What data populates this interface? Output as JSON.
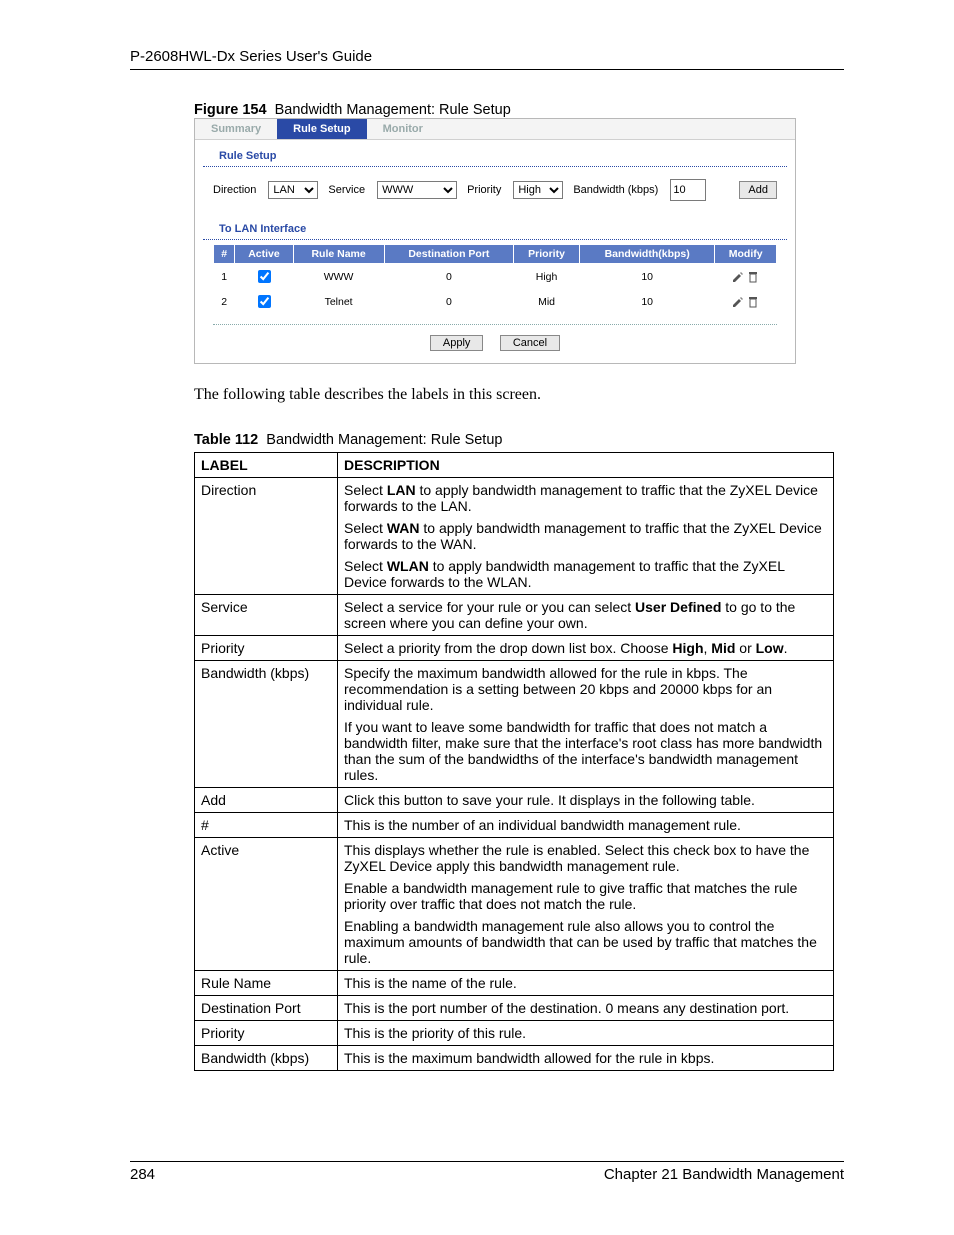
{
  "header": {
    "title": "P-2608HWL-Dx Series User's Guide"
  },
  "figure": {
    "label": "Figure 154",
    "title": "Bandwidth Management: Rule Setup"
  },
  "screenshot": {
    "tabs": {
      "summary": "Summary",
      "rule_setup": "Rule Setup",
      "monitor": "Monitor"
    },
    "section_rule_setup": "Rule Setup",
    "controls": {
      "direction_label": "Direction",
      "direction_value": "LAN",
      "service_label": "Service",
      "service_value": "WWW",
      "priority_label": "Priority",
      "priority_value": "High",
      "bandwidth_label": "Bandwidth (kbps)",
      "bandwidth_value": "10",
      "add_label": "Add"
    },
    "section_interface": "To LAN Interface",
    "columns": {
      "num": "#",
      "active": "Active",
      "rule_name": "Rule Name",
      "dest_port": "Destination Port",
      "priority": "Priority",
      "bandwidth": "Bandwidth(kbps)",
      "modify": "Modify"
    },
    "rows": [
      {
        "num": "1",
        "active": true,
        "rule_name": "WWW",
        "dest_port": "0",
        "priority": "High",
        "bandwidth": "10"
      },
      {
        "num": "2",
        "active": true,
        "rule_name": "Telnet",
        "dest_port": "0",
        "priority": "Mid",
        "bandwidth": "10"
      }
    ],
    "apply": "Apply",
    "cancel": "Cancel"
  },
  "intro_text": "The following table describes the labels in this screen.",
  "table_caption": {
    "label": "Table 112",
    "title": "Bandwidth Management: Rule Setup"
  },
  "desc_header": {
    "label": "LABEL",
    "description": "DESCRIPTION"
  },
  "desc_rows": {
    "direction": {
      "label": "Direction",
      "p1a": "Select ",
      "p1b": "LAN",
      "p1c": " to apply bandwidth management to traffic that the ZyXEL Device forwards to the LAN.",
      "p2a": "Select ",
      "p2b": "WAN",
      "p2c": " to apply bandwidth management to traffic that the ZyXEL Device forwards to the WAN.",
      "p3a": "Select ",
      "p3b": "WLAN",
      "p3c": " to apply bandwidth management to traffic that the ZyXEL Device forwards to the WLAN."
    },
    "service": {
      "label": "Service",
      "p1a": "Select a service for your rule or you can select ",
      "p1b": "User Defined",
      "p1c": " to go to the screen where you can define your own."
    },
    "priority": {
      "label": "Priority",
      "p1a": "Select a priority from the drop down list box. Choose ",
      "p1b": "High",
      "p1c": ", ",
      "p1d": "Mid",
      "p1e": " or ",
      "p1f": "Low",
      "p1g": "."
    },
    "bandwidth_kbps": {
      "label": "Bandwidth (kbps)",
      "p1": "Specify the maximum bandwidth allowed for the rule in kbps. The recommendation is a setting between 20 kbps and 20000 kbps for an individual rule.",
      "p2": "If you want to leave some bandwidth for traffic that does not match a bandwidth filter, make sure that the interface's root class has more bandwidth than the sum of the bandwidths of the interface's bandwidth management rules."
    },
    "add": {
      "label": "Add",
      "p1": "Click this button to save your rule. It displays in the following table."
    },
    "num": {
      "label": "#",
      "p1": "This is the number of an individual bandwidth management rule."
    },
    "active": {
      "label": "Active",
      "p1": "This displays whether the rule is enabled. Select this check box to have the ZyXEL Device apply this bandwidth management rule.",
      "p2": "Enable a bandwidth management rule to give traffic that matches the rule priority over traffic that does not match the rule.",
      "p3": "Enabling a bandwidth management rule also allows you to control the maximum amounts of bandwidth that can be used by traffic that matches the rule."
    },
    "rule_name": {
      "label": "Rule Name",
      "p1": "This is the name of the rule."
    },
    "dest_port": {
      "label": "Destination Port",
      "p1": "This is the port number of the destination. 0 means any destination port."
    },
    "priority2": {
      "label": "Priority",
      "p1": "This is the priority of this rule."
    },
    "bandwidth2": {
      "label": "Bandwidth (kbps)",
      "p1": "This is the maximum bandwidth allowed for the rule in kbps."
    }
  },
  "footer": {
    "page": "284",
    "chapter": "Chapter 21 Bandwidth Management"
  }
}
